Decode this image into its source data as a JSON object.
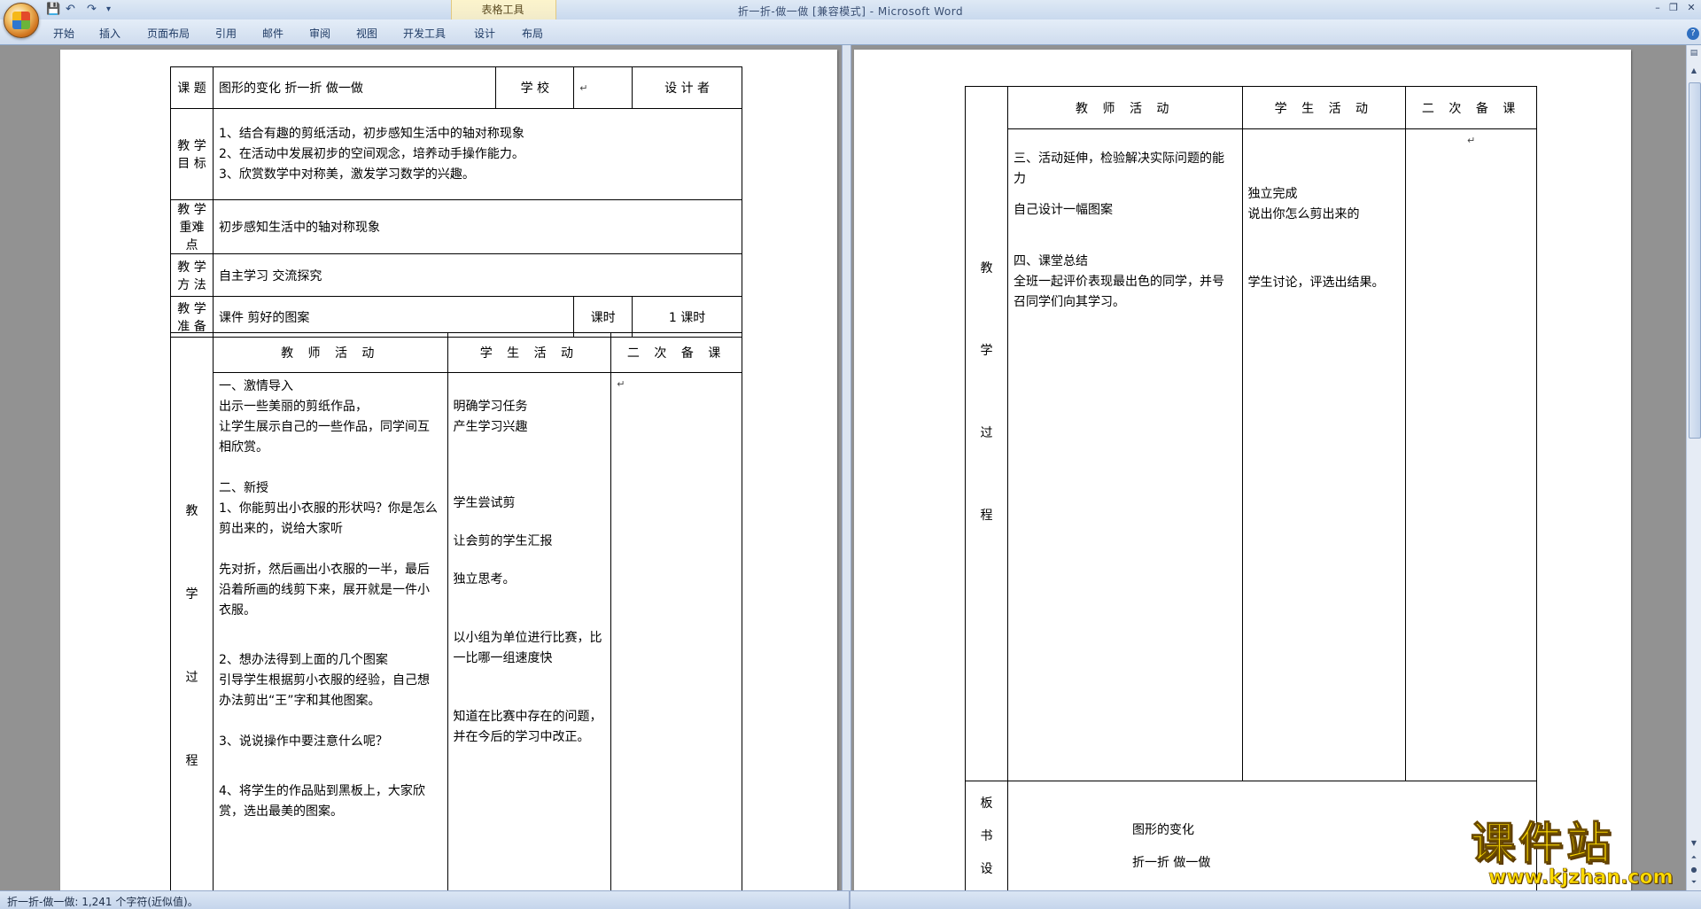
{
  "window": {
    "title": "折一折-做一做 [兼容模式] - Microsoft Word",
    "tool_group": "表格工具",
    "tabs": [
      "开始",
      "插入",
      "页面布局",
      "引用",
      "邮件",
      "审阅",
      "视图",
      "开发工具",
      "设计",
      "布局"
    ]
  },
  "status": {
    "text": "折一折-做一做: 1,241 个字符(近似值)。"
  },
  "page1": {
    "header": {
      "l_course": "课 题",
      "course": "图形的变化       折一折  做一做",
      "l_school": "学 校",
      "l_designer": "设 计 者"
    },
    "goals": {
      "label1": "教 学",
      "label2": "目 标",
      "items": [
        "1、结合有趣的剪纸活动，初步感知生活中的轴对称现象",
        "2、在活动中发展初步的空间观念，培养动手操作能力。",
        "3、欣赏数学中对称美，激发学习数学的兴趣。"
      ]
    },
    "difficulty": {
      "label1": "教 学",
      "label2": "重难点",
      "text": "初步感知生活中的轴对称现象"
    },
    "method": {
      "label1": "教 学",
      "label2": "方 法",
      "text": "自主学习    交流探究"
    },
    "prep": {
      "label1": "教 学",
      "label2": "准 备",
      "text": "课件     剪好的图案",
      "l_hours": "课时",
      "hours": "1 课时"
    },
    "cols": {
      "teacher": "教 师 活 动",
      "student": "学 生 活 动",
      "backup": "二 次 备 课"
    },
    "process_label": [
      "教",
      "学",
      "过",
      "程"
    ],
    "teacher": [
      "    一、激情导入",
      "    出示一些美丽的剪纸作品，",
      "    让学生展示自己的一些作品，同学间互相欣赏。",
      "",
      "    二、新授",
      "1、你能剪出小衣服的形状吗？你是怎么剪出来的，说给大家听",
      "",
      "先对折，然后画出小衣服的一半，最后沿着所画的线剪下来，展开就是一件小衣服。",
      "",
      "",
      "2、想办法得到上面的几个图案",
      "引导学生根据剪小衣服的经验，自己想办法剪出“王”字和其他图案。",
      "",
      "3、说说操作中要注意什么呢？",
      "",
      "",
      "4、将学生的作品贴到黑板上，大家欣赏，选出最美的图案。"
    ],
    "student": [
      "",
      "明确学习任务",
      "产生学习兴趣",
      "",
      "",
      "",
      "学生尝试剪",
      "",
      "让会剪的学生汇报",
      "",
      "独立思考。",
      "",
      "",
      "以小组为单位进行比赛，比一比哪一组速度快",
      "",
      "",
      "知道在比赛中存在的问题，并在今后的学习中改正。"
    ]
  },
  "page2": {
    "cols": {
      "teacher": "教 师 活 动",
      "student": "学 生 活 动",
      "backup": "二 次 备 课"
    },
    "process_label": [
      "教",
      "学",
      "过",
      "程"
    ],
    "teacher": [
      "    三、活动延伸，检验解决实际问题的能力",
      "",
      "    自己设计一幅图案",
      "",
      "",
      "    四、课堂总结",
      "    全班一起评价表现最出色的同学，并号召同学们向其学习。"
    ],
    "student": [
      "",
      "",
      "",
      "独立完成",
      "说出你怎么剪出来的",
      "",
      "",
      "",
      "学生讨论，评选出结果。"
    ],
    "board": {
      "label": [
        "板",
        "书",
        "设"
      ],
      "line1": "图形的变化",
      "line2": "折一折  做一做"
    }
  },
  "watermark": {
    "title": "课件站",
    "url": "www.kjzhan.com"
  },
  "colors": {
    "titlebar": "#dfe9f5",
    "doc_bg": "#929292",
    "watermark": "#ffdc00"
  }
}
